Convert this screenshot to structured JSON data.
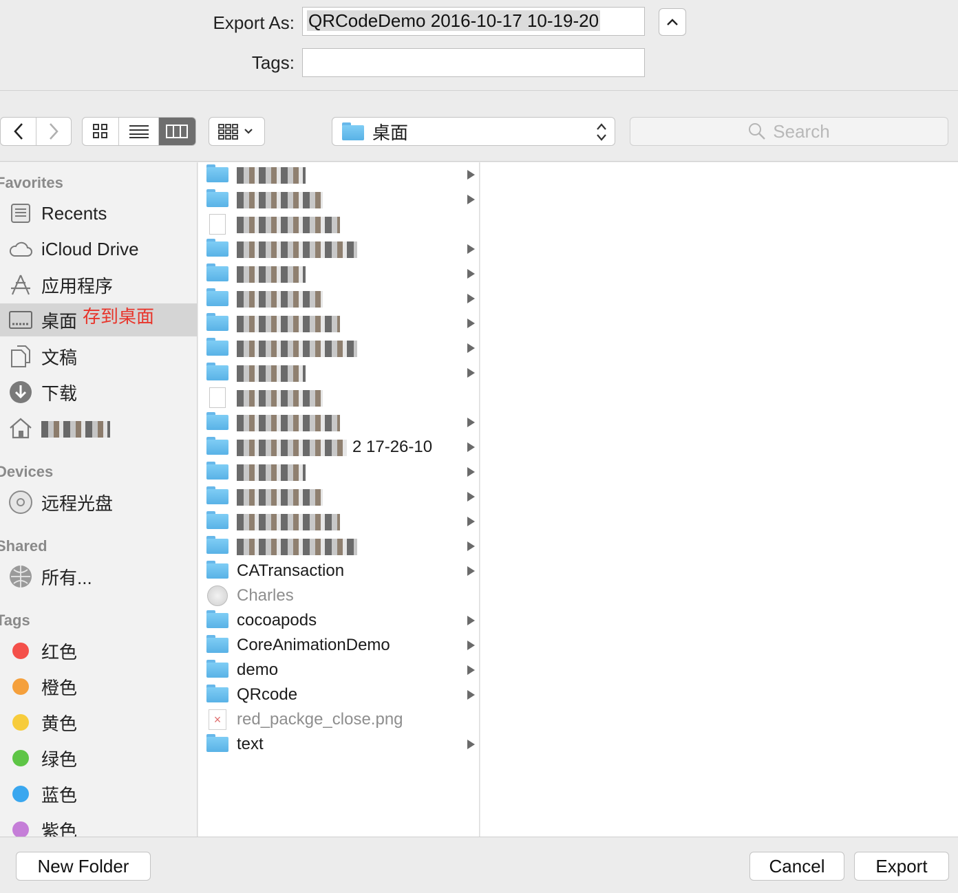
{
  "header": {
    "export_as_label": "Export As:",
    "export_as_value": "QRCodeDemo 2016-10-17 10-19-20",
    "tags_label": "Tags:",
    "tags_value": ""
  },
  "toolbar": {
    "location": "桌面",
    "search_placeholder": "Search",
    "view_mode": "columns"
  },
  "sidebar": {
    "favorites_title": "Favorites",
    "devices_title": "Devices",
    "shared_title": "Shared",
    "tags_title": "Tags",
    "favorites": [
      {
        "label": "Recents",
        "icon": "recents-icon"
      },
      {
        "label": "iCloud Drive",
        "icon": "cloud-icon"
      },
      {
        "label": "应用程序",
        "icon": "applications-icon"
      },
      {
        "label": "桌面",
        "icon": "desktop-icon",
        "selected": true
      },
      {
        "label": "文稿",
        "icon": "documents-icon"
      },
      {
        "label": "下载",
        "icon": "downloads-icon"
      },
      {
        "label": "",
        "icon": "home-icon"
      }
    ],
    "devices": [
      {
        "label": "远程光盘",
        "icon": "disc-icon"
      }
    ],
    "shared": [
      {
        "label": "所有...",
        "icon": "network-icon"
      }
    ],
    "tags": [
      {
        "label": "红色",
        "color": "#f4504a"
      },
      {
        "label": "橙色",
        "color": "#f5a03c"
      },
      {
        "label": "黄色",
        "color": "#f7cc3c"
      },
      {
        "label": "绿色",
        "color": "#5ec546"
      },
      {
        "label": "蓝色",
        "color": "#3aa7ef"
      },
      {
        "label": "紫色",
        "color": "#c57ed8"
      }
    ],
    "annotation": "存到桌面"
  },
  "files": [
    {
      "name": "",
      "type": "folder",
      "redacted": true,
      "arrow": true
    },
    {
      "name": "",
      "type": "folder",
      "redacted": true,
      "arrow": true
    },
    {
      "name": "",
      "type": "doc",
      "redacted": true,
      "arrow": false
    },
    {
      "name": "",
      "type": "folder",
      "redacted": true,
      "arrow": true
    },
    {
      "name": "",
      "type": "folder",
      "redacted": true,
      "arrow": true
    },
    {
      "name": "",
      "type": "folder",
      "redacted": true,
      "arrow": true
    },
    {
      "name": "",
      "type": "folder",
      "redacted": true,
      "arrow": true
    },
    {
      "name": "",
      "type": "folder",
      "redacted": true,
      "arrow": true
    },
    {
      "name": "",
      "type": "folder",
      "redacted": true,
      "arrow": true
    },
    {
      "name": "",
      "type": "doc",
      "redacted": true,
      "arrow": false
    },
    {
      "name": "",
      "type": "folder",
      "redacted": true,
      "arrow": true
    },
    {
      "name": "2 17-26-10",
      "type": "folder",
      "redacted": true,
      "arrow": true
    },
    {
      "name": "",
      "type": "folder",
      "redacted": true,
      "arrow": true
    },
    {
      "name": "",
      "type": "folder",
      "redacted": true,
      "arrow": true
    },
    {
      "name": "",
      "type": "folder",
      "redacted": true,
      "arrow": true
    },
    {
      "name": "",
      "type": "folder",
      "redacted": true,
      "arrow": true
    },
    {
      "name": "CATransaction",
      "type": "folder",
      "arrow": true
    },
    {
      "name": "Charles",
      "type": "app",
      "arrow": false,
      "dim": true
    },
    {
      "name": "cocoapods",
      "type": "folder",
      "arrow": true
    },
    {
      "name": "CoreAnimationDemo",
      "type": "folder",
      "arrow": true
    },
    {
      "name": "demo",
      "type": "folder",
      "arrow": true
    },
    {
      "name": "QRcode",
      "type": "folder",
      "arrow": true
    },
    {
      "name": "red_packge_close.png",
      "type": "image",
      "arrow": false,
      "dim": true
    },
    {
      "name": "text",
      "type": "folder",
      "arrow": true
    }
  ],
  "footer": {
    "new_folder": "New Folder",
    "cancel": "Cancel",
    "export": "Export"
  }
}
